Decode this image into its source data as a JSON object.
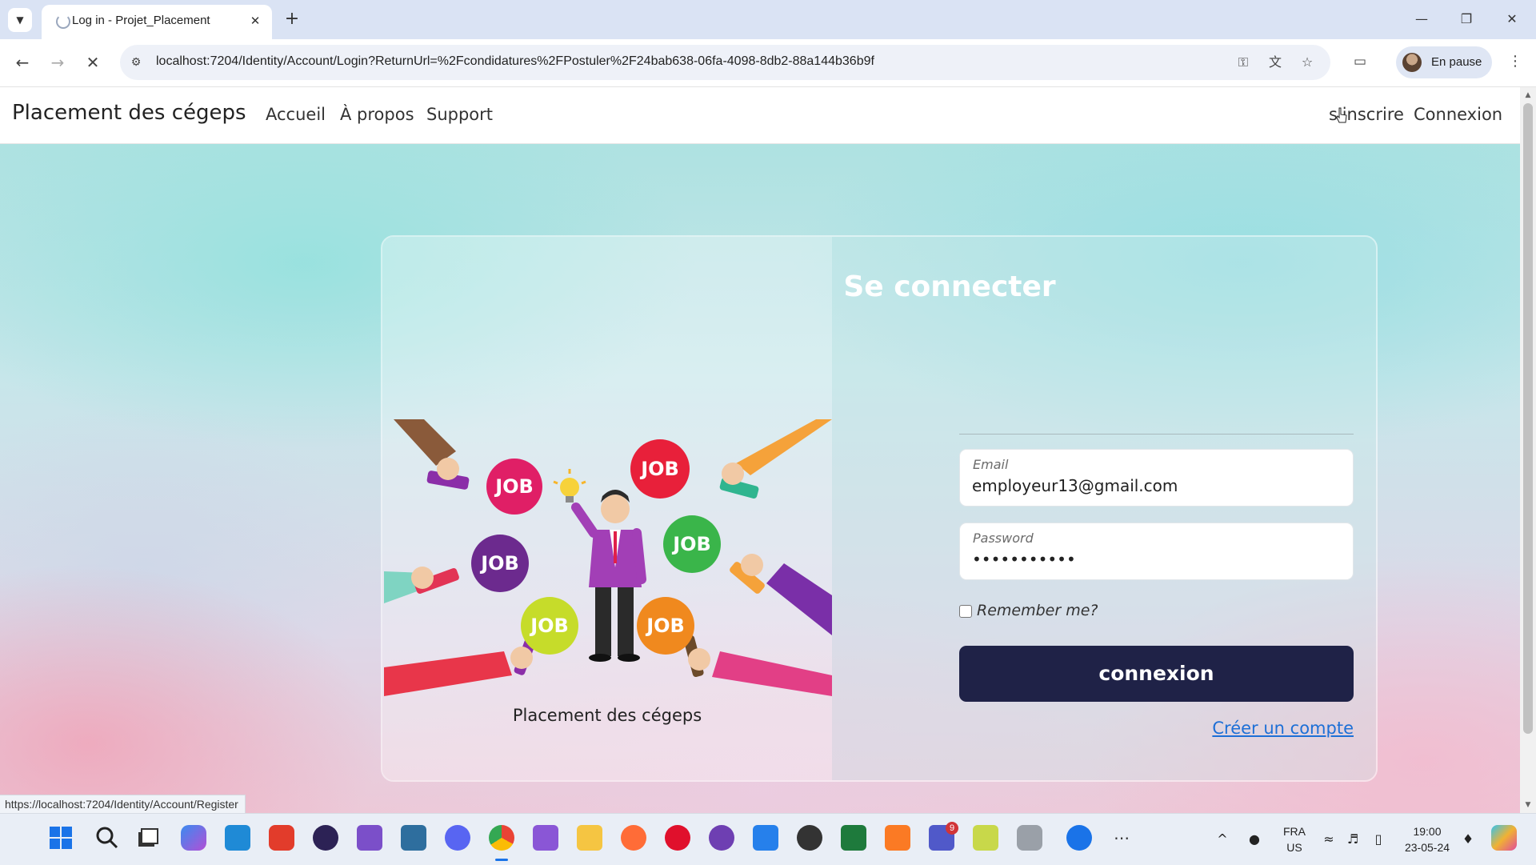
{
  "browser": {
    "tab_title": "Log in - Projet_Placement",
    "url": "localhost:7204/Identity/Account/Login?ReturnUrl=%2Fcondidatures%2FPostuler%2F24bab638-06fa-4098-8db2-88a144b36b9f",
    "profile_label": "En pause",
    "status_url": "https://localhost:7204/Identity/Account/Register"
  },
  "navbar": {
    "brand": "Placement des cégeps",
    "links": [
      "Accueil",
      "À propos",
      "Support"
    ],
    "right_links": [
      "s'inscrire",
      "Connexion"
    ]
  },
  "card": {
    "illustration_caption": "Placement des cégeps",
    "illustration_badges": [
      "JOB",
      "JOB",
      "JOB",
      "JOB",
      "JOB",
      "JOB"
    ],
    "title": "Se connecter",
    "email_label": "Email",
    "email_value": "employeur13@gmail.com",
    "password_label": "Password",
    "password_value": "•••••••••••",
    "remember_label": "Remember me?",
    "remember_checked": false,
    "submit_label": "connexion",
    "create_account_label": "Créer un compte"
  },
  "taskbar": {
    "language": "FRA",
    "region": "US",
    "time": "19:00",
    "date": "23-05-24",
    "teams_badge": "9",
    "icons": [
      "windows-start-icon",
      "search-icon",
      "task-view-icon",
      "copilot-icon",
      "vscode-icon",
      "wps-icon",
      "eclipse-icon",
      "visual-studio-icon",
      "mysql-workbench-icon",
      "discord-icon",
      "chrome-icon",
      "visual-studio-2-icon",
      "file-explorer-icon",
      "postman-icon",
      "opera-icon",
      "github-desktop-icon",
      "power-automate-icon",
      "obs-icon",
      "project-icon",
      "xampp-icon",
      "teams-icon",
      "android-studio-icon",
      "database-icon",
      "font-app-icon",
      "more-icon"
    ]
  },
  "colors": {
    "submit_bg": "#1f2247",
    "link": "#1d6fd6",
    "title": "#ffffff"
  }
}
